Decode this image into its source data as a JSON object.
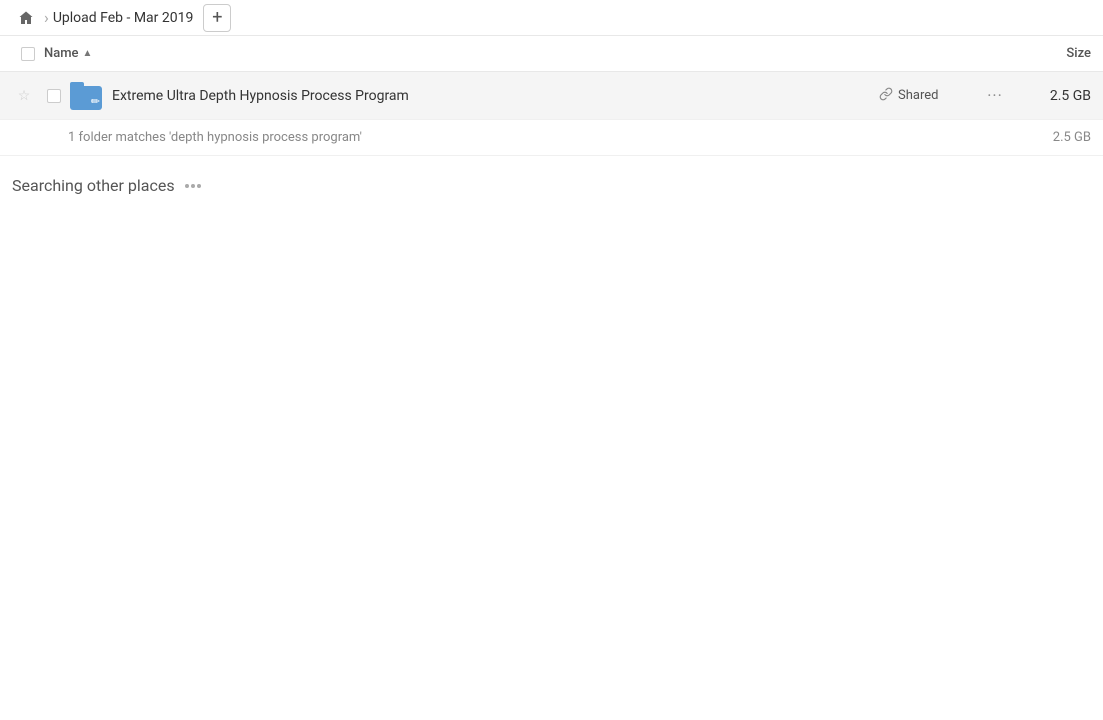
{
  "header": {
    "home_label": "Home",
    "breadcrumb_title": "Upload Feb - Mar 2019",
    "add_button_label": "+"
  },
  "columns": {
    "name_label": "Name",
    "size_label": "Size",
    "sort_indicator": "▲"
  },
  "file_row": {
    "name": "Extreme Ultra Depth Hypnosis Process Program",
    "shared_label": "Shared",
    "size": "2.5 GB",
    "more_label": "···"
  },
  "summary": {
    "text": "1 folder matches 'depth hypnosis process program'",
    "size": "2.5 GB"
  },
  "searching": {
    "title": "Searching other places"
  },
  "icons": {
    "home": "⌂",
    "chevron": "›",
    "link": "🔗",
    "star_empty": "☆",
    "pencil": "✏"
  }
}
